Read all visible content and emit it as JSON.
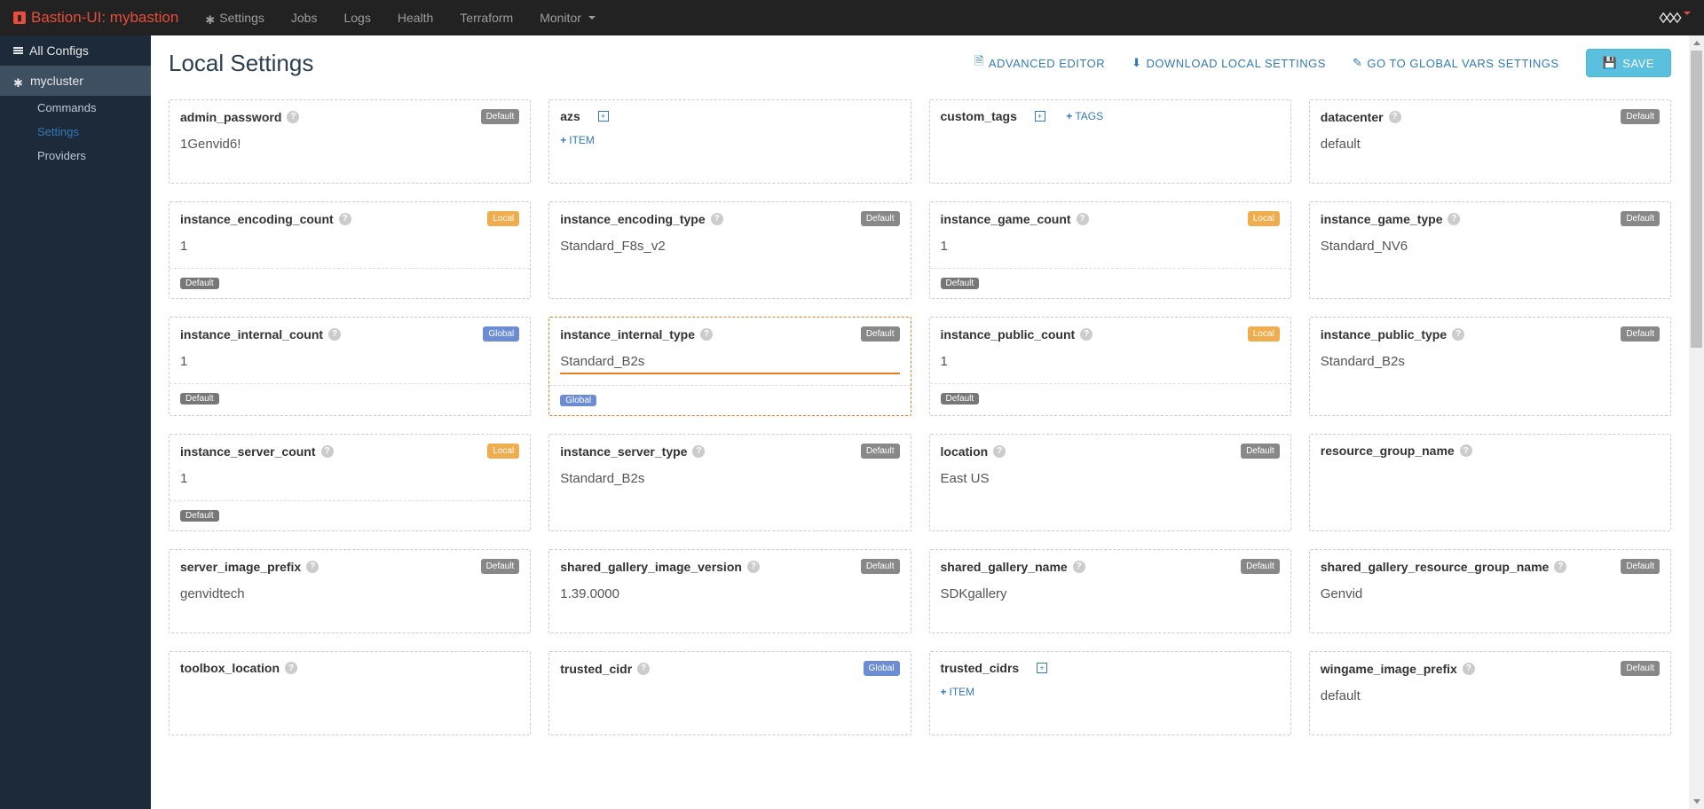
{
  "brand": "Bastion-UI: mybastion",
  "nav": {
    "settings": "Settings",
    "jobs": "Jobs",
    "logs": "Logs",
    "health": "Health",
    "terraform": "Terraform",
    "monitor": "Monitor"
  },
  "sidebar": {
    "all": "All Configs",
    "cluster": "mycluster",
    "subs": {
      "commands": "Commands",
      "settings": "Settings",
      "providers": "Providers"
    }
  },
  "page": {
    "title": "Local Settings",
    "adv": "ADVANCED EDITOR",
    "dl": "DOWNLOAD LOCAL SETTINGS",
    "global": "GO TO GLOBAL VARS SETTINGS",
    "save": "SAVE"
  },
  "badges": {
    "default": "Default",
    "local": "Local",
    "global": "Global"
  },
  "addItem": "ITEM",
  "addTags": "TAGS",
  "cards": {
    "admin_password": {
      "label": "admin_password",
      "value": "1Genvid6!"
    },
    "azs": {
      "label": "azs"
    },
    "custom_tags": {
      "label": "custom_tags"
    },
    "datacenter": {
      "label": "datacenter",
      "value": "default"
    },
    "instance_encoding_count": {
      "label": "instance_encoding_count",
      "value": "1"
    },
    "instance_encoding_type": {
      "label": "instance_encoding_type",
      "value": "Standard_F8s_v2"
    },
    "instance_game_count": {
      "label": "instance_game_count",
      "value": "1"
    },
    "instance_game_type": {
      "label": "instance_game_type",
      "value": "Standard_NV6"
    },
    "instance_internal_count": {
      "label": "instance_internal_count",
      "value": "1"
    },
    "instance_internal_type": {
      "label": "instance_internal_type",
      "value": "Standard_B2s"
    },
    "instance_public_count": {
      "label": "instance_public_count",
      "value": "1"
    },
    "instance_public_type": {
      "label": "instance_public_type",
      "value": "Standard_B2s"
    },
    "instance_server_count": {
      "label": "instance_server_count",
      "value": "1"
    },
    "instance_server_type": {
      "label": "instance_server_type",
      "value": "Standard_B2s"
    },
    "location": {
      "label": "location",
      "value": "East US"
    },
    "resource_group_name": {
      "label": "resource_group_name",
      "value": ""
    },
    "server_image_prefix": {
      "label": "server_image_prefix",
      "value": "genvidtech"
    },
    "shared_gallery_image_version": {
      "label": "shared_gallery_image_version",
      "value": "1.39.0000"
    },
    "shared_gallery_name": {
      "label": "shared_gallery_name",
      "value": "SDKgallery"
    },
    "shared_gallery_resource_group_name": {
      "label": "shared_gallery_resource_group_name",
      "value": "Genvid"
    },
    "toolbox_location": {
      "label": "toolbox_location",
      "value": ""
    },
    "trusted_cidr": {
      "label": "trusted_cidr",
      "value": ""
    },
    "trusted_cidrs": {
      "label": "trusted_cidrs"
    },
    "wingame_image_prefix": {
      "label": "wingame_image_prefix",
      "value": "default"
    }
  }
}
